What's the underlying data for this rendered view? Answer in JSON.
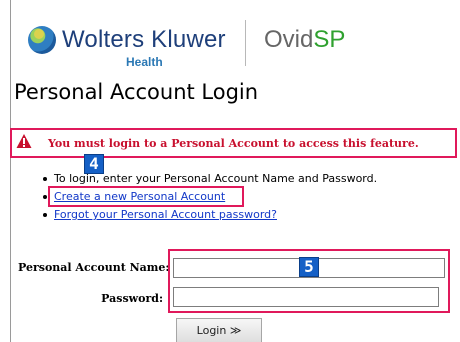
{
  "header": {
    "brand": "Wolters Kluwer",
    "brand_sub": "Health",
    "product_prefix": "Ovid",
    "product_suffix": "SP"
  },
  "page_title": "Personal Account Login",
  "alert": {
    "icon": "warning-triangle-icon",
    "message": "You must login to a Personal Account to access this feature."
  },
  "step_badges": [
    "4",
    "5"
  ],
  "instructions": {
    "intro": "To login, enter your Personal Account Name and Password.",
    "create_link": "Create a new Personal Account",
    "forgot_link": "Forgot your Personal Account password?"
  },
  "form": {
    "name_label": "Personal Account Name:",
    "name_value": "",
    "password_label": "Password:",
    "password_value": "",
    "login_label": "Login ≫"
  },
  "colors": {
    "highlight": "#e0195b",
    "link": "#1238c8",
    "alert_text": "#c8102e",
    "badge": "#1560c6",
    "brand": "#1e3f7a",
    "product_accent": "#2fa12f"
  }
}
